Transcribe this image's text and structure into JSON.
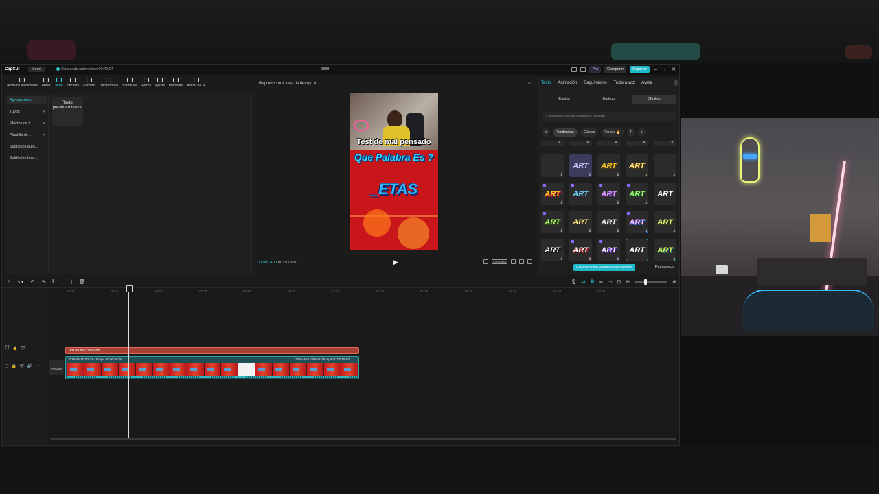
{
  "titlebar": {
    "app_name": "CapCut",
    "menu_label": "Menú",
    "autosave": "Guardado automático 00:49:24",
    "project_name": "0809",
    "pro_label": "Pro",
    "share_label": "Compartir",
    "export_label": "Exportar"
  },
  "toolbar": {
    "items": [
      "Archivos multimedia",
      "Audio",
      "Texto",
      "Stickers",
      "Efectos",
      "Transiciones",
      "Subtítulos",
      "Filtros",
      "Ajuste",
      "Plantillas",
      "Avatar de IA"
    ],
    "active": "Texto"
  },
  "left_panel": {
    "categories": [
      "Agregar texto",
      "Tuyos",
      "Efectos de t...",
      "Plantilla de ...",
      "Subtítulos auto...",
      "Subtítulos loca..."
    ],
    "card_label": "Texto predetermina do"
  },
  "player": {
    "title": "Reproductor-Línea de tiempo 01",
    "caption_1": "Test de mal pensado",
    "caption_2": "Que Palabra Es ?",
    "caption_3": "_ETAS",
    "current_time": "00:00:14:11",
    "total_time": "00:01:06:07",
    "ratio_label": "Completa"
  },
  "right_panel": {
    "tabs": [
      "Texto",
      "Animación",
      "Seguimiento",
      "Texto a voz",
      "Avata"
    ],
    "active_tab": "Texto",
    "subtabs": [
      "Básico",
      "Burbuja",
      "Efectos"
    ],
    "active_subtab": "Efectos",
    "search_placeholder": "Búsqueda de efectos/estilos de texto",
    "filters": [
      "Tendencias",
      "Clásica",
      "Verano 🔥"
    ],
    "effect_label": "ART",
    "save_label": "Guardar como parámetro predefinido",
    "reset_label": "Restablecer"
  },
  "timeline": {
    "ruler": [
      "00:00",
      "00:10",
      "00:20",
      "00:30",
      "00:40",
      "00:50",
      "01:00",
      "01:10",
      "01:20",
      "01:30",
      "01:40",
      "01:50",
      "02:00"
    ],
    "text_clip": "Test de mal pensado",
    "video_clip_1": "2026-08-10 00-22-15.mp4   00:00:59:06",
    "video_clip_2": "2026-08-10 00-22-15.mp4   00:00:15:00",
    "cover_label": "Portada"
  },
  "colors": {
    "accent": "#2ed0df",
    "export": "#1fb9c9",
    "text_clip": "#a64135",
    "video_clip": "#1f4e55"
  }
}
